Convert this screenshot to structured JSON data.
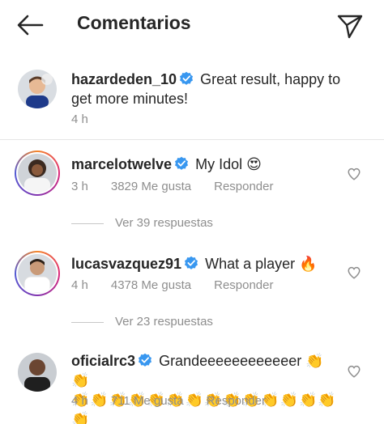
{
  "header": {
    "title": "Comentarios"
  },
  "caption": {
    "username": "hazardeden_10",
    "text": "Great result, happy to get more minutes!",
    "time": "4 h"
  },
  "comments": [
    {
      "username": "marcelotwelve",
      "text": "My Idol 😍",
      "time": "3 h",
      "likes": "3829 Me gusta",
      "reply_label": "Responder",
      "replies": "Ver 39 respuestas"
    },
    {
      "username": "lucasvazquez91",
      "text": "What a player 🔥",
      "time": "4 h",
      "likes": "4378 Me gusta",
      "reply_label": "Responder",
      "replies": "Ver 23 respuestas"
    },
    {
      "username": "oficialrc3",
      "text": "Grandeeeeeeeeeeeer 👏👏",
      "text_line2": "👏👏👏👏👏👏👏👏👏👏👏👏👏👏👏",
      "time": "4 h",
      "likes": "711 Me gusta",
      "reply_label": "Responder"
    }
  ],
  "colors": {
    "verified": "#3897f0",
    "muted": "#8e8e8e",
    "text": "#262626"
  },
  "icons": {
    "back": "arrow-left-icon",
    "send": "paper-plane-icon",
    "verified": "verified-badge-icon",
    "like": "heart-outline-icon"
  }
}
